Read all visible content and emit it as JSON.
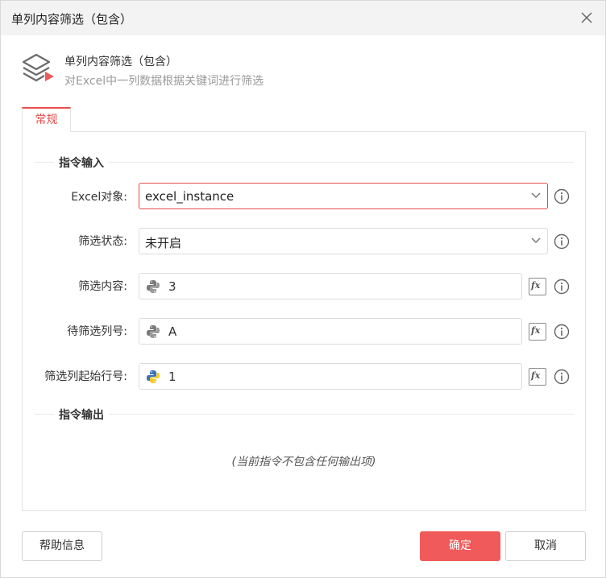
{
  "window": {
    "title": "单列内容筛选（包含）"
  },
  "header": {
    "title": "单列内容筛选（包含）",
    "description": "对Excel中一列数据根据关键词进行筛选",
    "icon": "layers-icon"
  },
  "tabs": [
    {
      "label": "常规",
      "active": true
    }
  ],
  "input_section": {
    "title": "指令输入",
    "fields": [
      {
        "label": "Excel对象:",
        "type": "select",
        "value": "excel_instance",
        "focused": true
      },
      {
        "label": "筛选状态:",
        "type": "select",
        "value": "未开启"
      },
      {
        "label": "筛选内容:",
        "type": "expression",
        "value": "3"
      },
      {
        "label": "待筛选列号:",
        "type": "expression",
        "value": "A"
      },
      {
        "label": "筛选列起始行号:",
        "type": "expression",
        "value": "1"
      }
    ]
  },
  "output_section": {
    "title": "指令输出",
    "empty_text": "(当前指令不包含任何输出项)"
  },
  "buttons": {
    "help": "帮助信息",
    "ok": "确定",
    "cancel": "取消"
  },
  "colors": {
    "accent": "#e84c4c",
    "primary_button": "#f15a5a",
    "titlebar_bg": "#f3f3f3"
  }
}
